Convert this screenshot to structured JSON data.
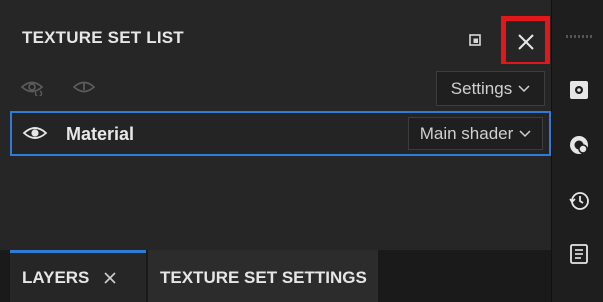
{
  "panel": {
    "title": "TEXTURE SET LIST",
    "restore_icon": "restore-window-icon",
    "close_icon": "close-icon"
  },
  "toolbar": {
    "icons": [
      "eye-refresh-icon",
      "info-circle-icon"
    ],
    "settings_label": "Settings"
  },
  "material_row": {
    "label": "Material",
    "shader_label": "Main shader"
  },
  "tabs": [
    {
      "label": "LAYERS",
      "active": true
    },
    {
      "label": "TEXTURE SET SETTINGS",
      "active": false
    }
  ],
  "right_sidebar": {
    "icons": [
      "display-settings-icon",
      "bake-icon",
      "history-icon",
      "log-icon"
    ]
  },
  "colors": {
    "accent": "#2f7bd6",
    "highlight": "#e0171b"
  }
}
